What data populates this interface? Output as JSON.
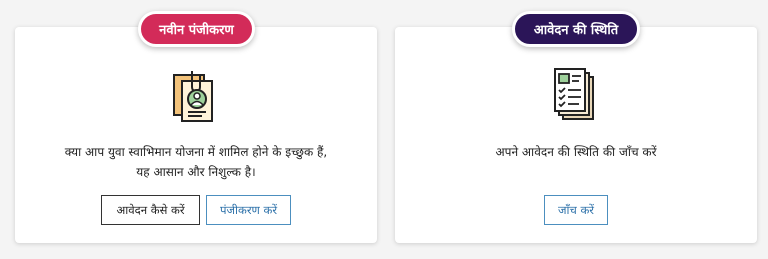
{
  "registration_card": {
    "badge": "नवीन पंजीकरण",
    "description_line1": "क्या आप युवा स्वाभिमान योजना में शामिल होने के इच्छुक हैं,",
    "description_line2": "यह आसान और निशुल्क है।",
    "how_to_apply_button": "आवेदन कैसे करें",
    "register_button": "पंजीकरण करें",
    "icon": "profile-document-icon"
  },
  "status_card": {
    "badge": "आवेदन की स्थिति",
    "description": "अपने आवेदन की स्थिति की जाँच करें",
    "check_button": "जाँच करें",
    "icon": "checklist-document-icon"
  },
  "colors": {
    "new_badge": "#d32b59",
    "status_badge": "#2b1558",
    "link_button": "#2a6fa8"
  }
}
